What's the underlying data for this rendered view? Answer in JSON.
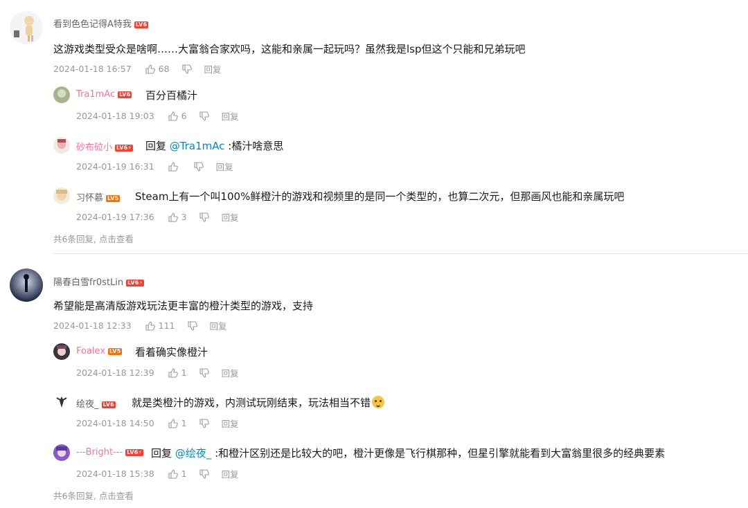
{
  "threads": [
    {
      "user": "看到色色记得A特我",
      "level": "LV6",
      "text": "这游戏类型受众是啥啊……大富翁合家欢吗，这能和亲属一起玩吗？虽然我是lsp但这个只能和兄弟玩吧",
      "time": "2024-01-18 16:57",
      "likes": "68",
      "reply_label": "回复",
      "replies": [
        {
          "user": "Tra1mAc",
          "level": "LV6",
          "text": "百分百橘汁",
          "time": "2024-01-18 19:03",
          "likes": "6",
          "reply_label": "回复"
        },
        {
          "user": "砂布砬小",
          "level": "LV6⚡",
          "reply_prefix": "回复 ",
          "mention": "@Tra1mAc",
          "text": " :橘汁啥意思",
          "time": "2024-01-19 16:31",
          "likes": "",
          "reply_label": "回复"
        },
        {
          "user": "习怀慕",
          "level": "LV5",
          "text": "Steam上有一个叫100%鲜橙汁的游戏和视频里的是同一个类型的，也算二次元，但那画风也能和亲属玩吧",
          "time": "2024-01-19 17:36",
          "likes": "3",
          "reply_label": "回复"
        }
      ],
      "more": "共6条回复, 点击查看"
    },
    {
      "user": "陽春白雪fr0stLin",
      "level": "LV6⚡",
      "text": "希望能是高清版游戏玩法更丰富的橙汁类型的游戏，支持",
      "time": "2024-01-18 12:33",
      "likes": "111",
      "reply_label": "回复",
      "replies": [
        {
          "user": "Foalex",
          "level": "LV5",
          "text": "看着确实像橙汁",
          "time": "2024-01-18 12:39",
          "likes": "1",
          "reply_label": "回复"
        },
        {
          "user": "绘夜_",
          "level": "LV6",
          "text": "就是类橙汁的游戏，内测试玩刚结束，玩法相当不错",
          "time": "2024-01-18 14:50",
          "likes": "1",
          "reply_label": "回复"
        },
        {
          "user": "---Bright---",
          "level": "LV6⚡",
          "reply_prefix": "回复 ",
          "mention": "@绘夜_",
          "text": " :和橙汁区别还是比较大的吧，橙汁更像是飞行棋那种，但星引擎就能看到大富翁里很多的经典要素",
          "time": "2024-01-18 15:38",
          "likes": "1",
          "reply_label": "回复"
        }
      ],
      "more": "共6条回复, 点击查看"
    }
  ],
  "colors": {
    "accent": "#fb7299",
    "link": "#008ac5",
    "muted": "#9499a0",
    "level": "#ff3b30"
  },
  "icons": {
    "like": "thumb-up-icon",
    "dislike": "thumb-down-icon"
  }
}
